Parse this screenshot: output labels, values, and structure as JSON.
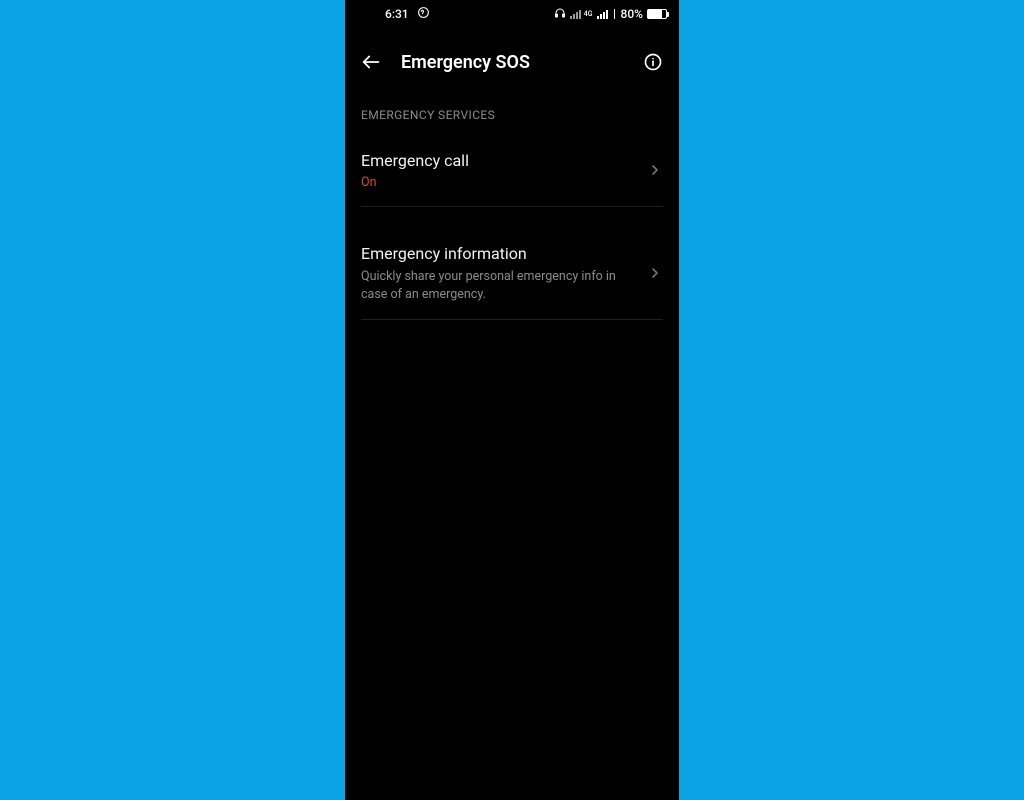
{
  "statusbar": {
    "time": "6:31",
    "battery_pct": "80%",
    "network_label": "4G"
  },
  "header": {
    "title": "Emergency SOS"
  },
  "section": {
    "label": "EMERGENCY SERVICES"
  },
  "items": {
    "emergency_call": {
      "title": "Emergency call",
      "status": "On"
    },
    "emergency_info": {
      "title": "Emergency information",
      "subtitle": "Quickly share your personal emergency info in case of an emergency."
    }
  }
}
